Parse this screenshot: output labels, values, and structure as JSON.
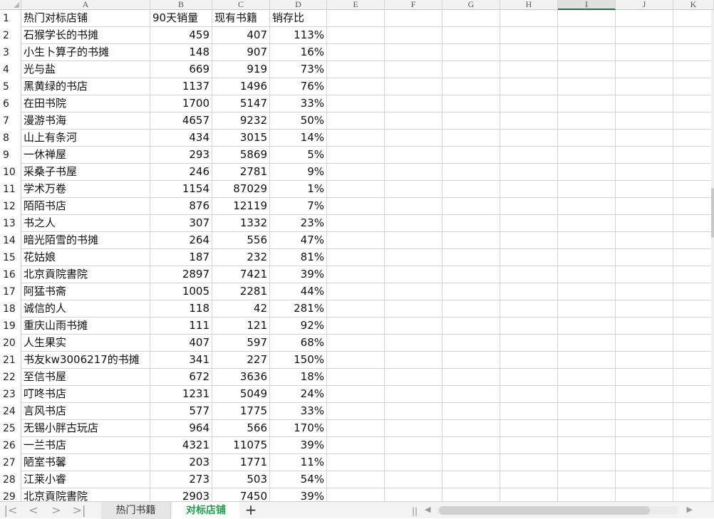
{
  "columns": [
    "A",
    "B",
    "C",
    "D",
    "E",
    "F",
    "G",
    "H",
    "I",
    "J",
    "K"
  ],
  "selected_column": "I",
  "header_row": {
    "name": "热门对标店铺",
    "sales90": "90天销量",
    "stock": "现有书籍",
    "ratio": "销存比"
  },
  "rows": [
    {
      "n": "2",
      "name": "石猴学长的书摊",
      "sales90": "459",
      "stock": "407",
      "ratio": "113%"
    },
    {
      "n": "3",
      "name": "小生卜算子的书摊",
      "sales90": "148",
      "stock": "907",
      "ratio": "16%"
    },
    {
      "n": "4",
      "name": "光与盐",
      "sales90": "669",
      "stock": "919",
      "ratio": "73%"
    },
    {
      "n": "5",
      "name": "黑黄绿的书店",
      "sales90": "1137",
      "stock": "1496",
      "ratio": "76%"
    },
    {
      "n": "6",
      "name": "在田书院",
      "sales90": "1700",
      "stock": "5147",
      "ratio": "33%"
    },
    {
      "n": "7",
      "name": "漫游书海",
      "sales90": "4657",
      "stock": "9232",
      "ratio": "50%"
    },
    {
      "n": "8",
      "name": "山上有条河",
      "sales90": "434",
      "stock": "3015",
      "ratio": "14%"
    },
    {
      "n": "9",
      "name": "一休禅屋",
      "sales90": "293",
      "stock": "5869",
      "ratio": "5%"
    },
    {
      "n": "10",
      "name": "采桑子书屋",
      "sales90": "246",
      "stock": "2781",
      "ratio": "9%"
    },
    {
      "n": "11",
      "name": "学术万卷",
      "sales90": "1154",
      "stock": "87029",
      "ratio": "1%"
    },
    {
      "n": "12",
      "name": "陌陌书店",
      "sales90": "876",
      "stock": "12119",
      "ratio": "7%"
    },
    {
      "n": "13",
      "name": "书之人",
      "sales90": "307",
      "stock": "1332",
      "ratio": "23%"
    },
    {
      "n": "14",
      "name": "暗光陌雪的书摊",
      "sales90": "264",
      "stock": "556",
      "ratio": "47%"
    },
    {
      "n": "15",
      "name": "花姑娘",
      "sales90": "187",
      "stock": "232",
      "ratio": "81%"
    },
    {
      "n": "16",
      "name": "北京貢院書院",
      "sales90": "2897",
      "stock": "7421",
      "ratio": "39%"
    },
    {
      "n": "17",
      "name": "阿猛书斋",
      "sales90": "1005",
      "stock": "2281",
      "ratio": "44%"
    },
    {
      "n": "18",
      "name": "诚信的人",
      "sales90": "118",
      "stock": "42",
      "ratio": "281%"
    },
    {
      "n": "19",
      "name": "重庆山雨书摊",
      "sales90": "111",
      "stock": "121",
      "ratio": "92%"
    },
    {
      "n": "20",
      "name": "人生果实",
      "sales90": "407",
      "stock": "597",
      "ratio": "68%"
    },
    {
      "n": "21",
      "name": "书友kw3006217的书摊",
      "sales90": "341",
      "stock": "227",
      "ratio": "150%"
    },
    {
      "n": "22",
      "name": "至信书屋",
      "sales90": "672",
      "stock": "3636",
      "ratio": "18%"
    },
    {
      "n": "23",
      "name": "叮咚书店",
      "sales90": "1231",
      "stock": "5049",
      "ratio": "24%"
    },
    {
      "n": "24",
      "name": "言风书店",
      "sales90": "577",
      "stock": "1775",
      "ratio": "33%"
    },
    {
      "n": "25",
      "name": "无锡小胖古玩店",
      "sales90": "964",
      "stock": "566",
      "ratio": "170%"
    },
    {
      "n": "26",
      "name": "一兰书店",
      "sales90": "4321",
      "stock": "11075",
      "ratio": "39%"
    },
    {
      "n": "27",
      "name": "陋室书馨",
      "sales90": "203",
      "stock": "1771",
      "ratio": "11%"
    },
    {
      "n": "28",
      "name": "江莱小睿",
      "sales90": "273",
      "stock": "503",
      "ratio": "54%"
    },
    {
      "n": "29",
      "name": "北京貢院書院",
      "sales90": "2903",
      "stock": "7450",
      "ratio": "39%"
    }
  ],
  "sheet_tabs": [
    {
      "label": "热门书籍",
      "active": false
    },
    {
      "label": "对标店铺",
      "active": true
    }
  ],
  "colors": {
    "accent": "#1e9e4a",
    "grid": "#d4d4d4",
    "header_bg": "#f2f2f2"
  },
  "icons": {
    "first": "first-sheet-icon",
    "prev": "prev-sheet-icon",
    "next": "next-sheet-icon",
    "last": "last-sheet-icon",
    "add": "add-sheet-icon"
  }
}
